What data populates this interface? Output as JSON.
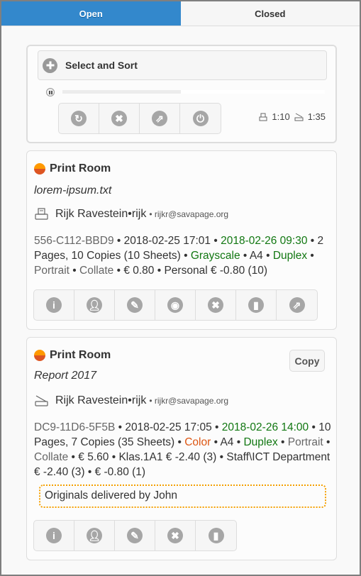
{
  "tabs": [
    {
      "label": "Open",
      "active": true
    },
    {
      "label": "Closed",
      "active": false
    }
  ],
  "controls": {
    "collapsible_label": "Select and Sort",
    "progress_percent": 45,
    "buttons": [
      {
        "name": "refresh",
        "glyph": "↻"
      },
      {
        "name": "cancel",
        "glyph": "✖"
      },
      {
        "name": "export",
        "glyph": "⇗"
      },
      {
        "name": "power",
        "glyph": "⏻"
      }
    ],
    "stats": {
      "printer_ratio": "1:10",
      "scanner_ratio": "1:35"
    }
  },
  "jobs": [
    {
      "printer": "Print Room",
      "document": "lorem-ipsum.txt",
      "device_type": "printer",
      "user_name": "Rijk Ravestein",
      "user_id": "rijk",
      "email": "rijkr@savapage.org",
      "job_id": "556-C112-BBD9",
      "submitted": "2018-02-25 17:01",
      "due": "2018-02-26 09:30",
      "pages_copies": "2 Pages, 10 Copies (10 Sheets)",
      "color_mode": "Grayscale",
      "paper": "A4",
      "sides": "Duplex",
      "orientation": "Portrait",
      "collate": "Collate",
      "cost": "€ 0.80",
      "accounts": "Personal € -0.80 (10)",
      "actions": [
        "info",
        "user",
        "edit",
        "preview",
        "cancel",
        "bag",
        "export"
      ]
    },
    {
      "printer": "Print Room",
      "document": "Report 2017",
      "device_type": "scanner",
      "user_name": "Rijk Ravestein",
      "user_id": "rijk",
      "email": "rijkr@savapage.org",
      "copy_label": "Copy",
      "job_id": "DC9-11D6-5F5B",
      "submitted": "2018-02-25 17:05",
      "due": "2018-02-26 14:00",
      "pages_copies": "10 Pages, 7 Copies (35 Sheets)",
      "color_mode": "Color",
      "paper": "A4",
      "sides": "Duplex",
      "orientation": "Portrait",
      "collate": "Collate",
      "cost": "€ 5.60",
      "account_1": "Klas.1A1 € -2.40 (3)",
      "account_2": "Staff\\ICT Department € -2.40 (3)",
      "account_3": "€ -0.80 (1)",
      "comment": "Originals delivered by John",
      "actions": [
        "info",
        "user",
        "edit",
        "cancel",
        "bag"
      ]
    }
  ],
  "separator": " • "
}
